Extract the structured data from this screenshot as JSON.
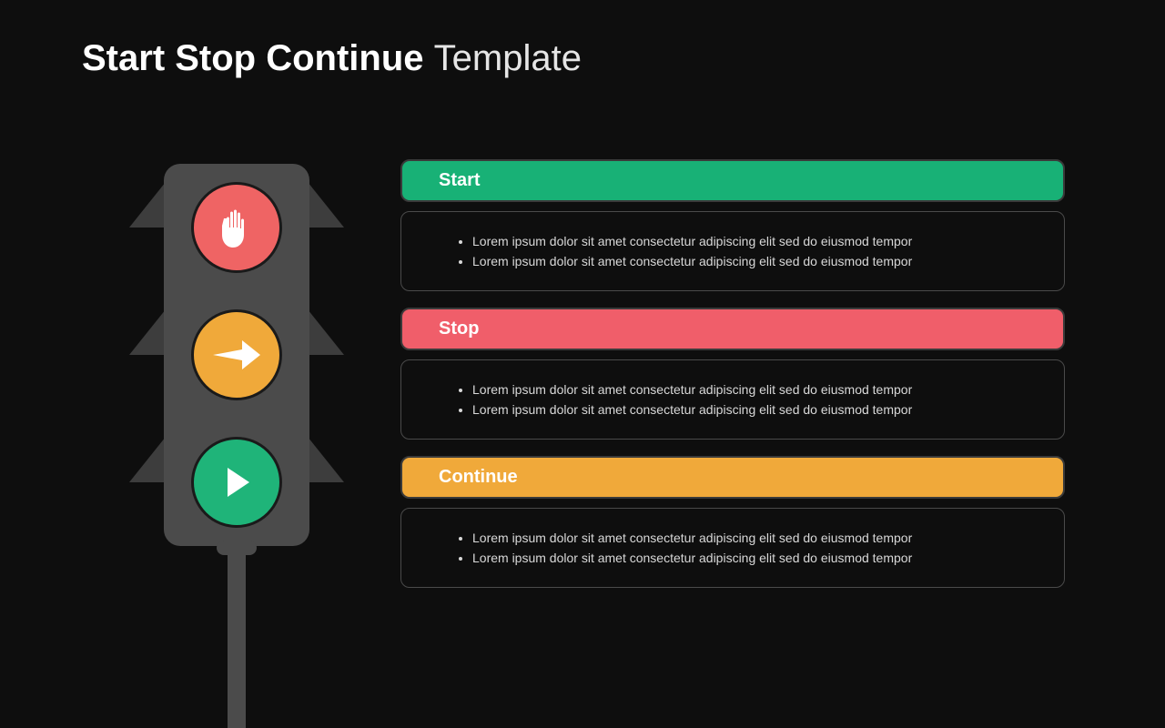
{
  "title": {
    "bold": "Start Stop Continue",
    "thin": "Template"
  },
  "sections": [
    {
      "label": "Start",
      "color": "green",
      "bullets": [
        "Lorem ipsum dolor sit amet consectetur adipiscing elit sed do eiusmod tempor",
        "Lorem ipsum dolor sit amet consectetur adipiscing elit sed do eiusmod tempor"
      ]
    },
    {
      "label": "Stop",
      "color": "red",
      "bullets": [
        "Lorem ipsum dolor sit amet consectetur adipiscing elit sed do eiusmod tempor",
        "Lorem ipsum dolor sit amet consectetur adipiscing elit sed do eiusmod tempor"
      ]
    },
    {
      "label": "Continue",
      "color": "orange",
      "bullets": [
        "Lorem ipsum dolor sit amet consectetur adipiscing elit sed do eiusmod tempor",
        "Lorem ipsum dolor sit amet consectetur adipiscing elit sed do eiusmod tempor"
      ]
    }
  ],
  "lights": [
    {
      "name": "stop-hand-icon",
      "color": "red"
    },
    {
      "name": "arrow-right-icon",
      "color": "yellow"
    },
    {
      "name": "play-icon",
      "color": "green"
    }
  ]
}
